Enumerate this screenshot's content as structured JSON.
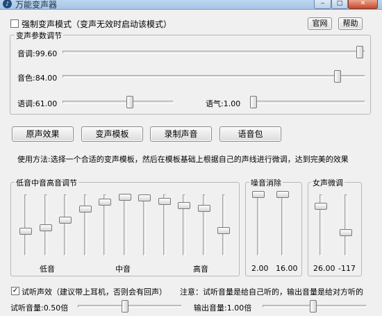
{
  "window": {
    "title": "万能变声器",
    "minimize": "‒",
    "maximize": "□",
    "close": "✕"
  },
  "top": {
    "force_mode": "强制变声模式（变声无效时启动该模式）",
    "force_checked": false,
    "website_button": "官网",
    "help_button": "帮助"
  },
  "params": {
    "legend": "变声参数调节",
    "pitch": {
      "label": "音调:99.60",
      "value": 99.6
    },
    "timbre": {
      "label": "音色:84.00",
      "value": 84.0
    },
    "speed": {
      "label": "语调:61.00",
      "value": 61.0
    },
    "tone": {
      "label": "语气:1.00",
      "value": 1.0
    }
  },
  "buttons": {
    "original": "原声效果",
    "template": "变声模板",
    "record": "录制声音",
    "pack": "语音包"
  },
  "usage": "使用方法:选择一个合适的变声模板，然后在模板基础上根据自己的声线进行微调，达到完美的效果",
  "eq": {
    "legend": "低音中音高音调节",
    "low": "低音",
    "mid": "中音",
    "high": "高音",
    "levels": [
      40,
      45,
      58,
      76,
      87,
      95,
      94,
      89,
      82,
      77,
      41
    ]
  },
  "noise": {
    "legend": "噪音消除",
    "val1": "2.00",
    "val2": "16.00",
    "levels": [
      100,
      100
    ]
  },
  "female": {
    "legend": "女声微调",
    "val1": "26.00",
    "val2": "-117",
    "levels": [
      81,
      37
    ]
  },
  "monitor": {
    "label": "试听声效（建议带上耳机，否则会有回声）",
    "checked": true,
    "note": "注意：试听音量是给自己听的，输出音量是给对方听的"
  },
  "volume": {
    "listen_label": "试听音量:0.50倍",
    "listen_value": 0.5,
    "output_label": "输出音量:1.00倍",
    "output_value": 1.0
  }
}
